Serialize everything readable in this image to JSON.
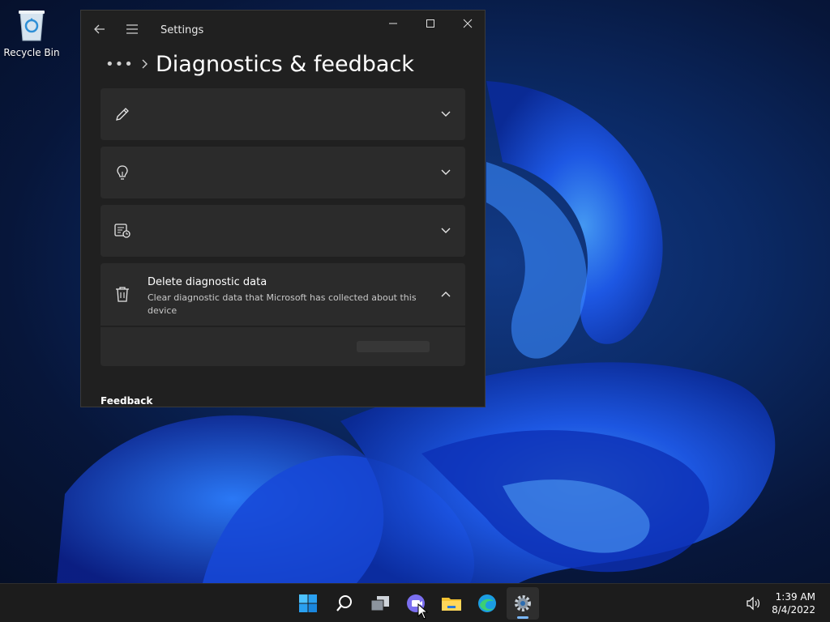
{
  "desktop": {
    "recycle_bin_label": "Recycle Bin"
  },
  "window": {
    "app_title": "Settings",
    "breadcrumb_more": "•••",
    "page_title": "Diagnostics & feedback",
    "cards": [
      {
        "icon": "pen-icon",
        "expanded": false
      },
      {
        "icon": "lightbulb-icon",
        "expanded": false
      },
      {
        "icon": "diagnostic-viewer-icon",
        "expanded": false
      },
      {
        "icon": "trash-icon",
        "title": "Delete diagnostic data",
        "description": "Clear diagnostic data that Microsoft has collected about this device",
        "expanded": true
      }
    ],
    "section_feedback": "Feedback"
  },
  "taskbar": {
    "icons": [
      "start-icon",
      "search-icon",
      "task-view-icon",
      "chat-icon",
      "file-explorer-icon",
      "edge-icon",
      "settings-icon"
    ],
    "active": "settings-icon",
    "time": "1:39 AM",
    "date": "8/4/2022"
  },
  "colors": {
    "window_bg": "#202020",
    "card_bg": "#2b2b2b",
    "taskbar_bg": "#1c1c1c",
    "accent": "#7ab8ff"
  }
}
